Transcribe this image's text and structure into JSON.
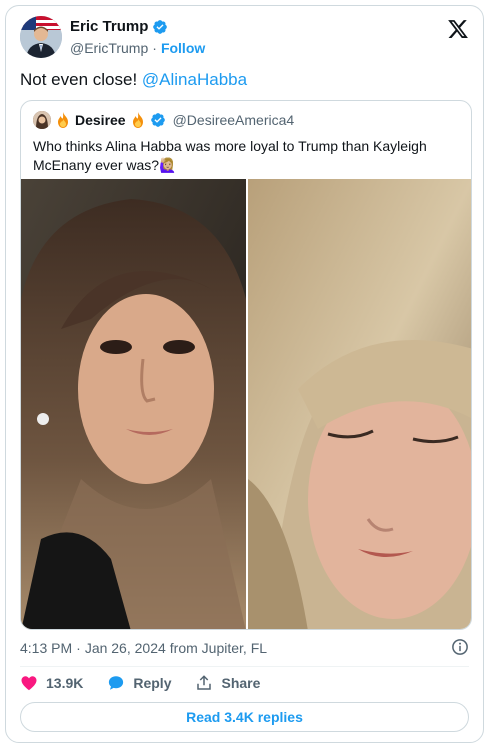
{
  "author": {
    "name": "Eric Trump",
    "handle": "@EricTrump",
    "separator": "·",
    "follow_label": "Follow",
    "avatar_icon": "profile-photo-eric-trump"
  },
  "tweet": {
    "text": "Not even close! ",
    "mention": "@AlinaHabba"
  },
  "quoted": {
    "name": "Desiree",
    "handle": "@DesireeAmerica4",
    "text": "Who thinks Alina Habba was more loyal to Trump than Kayleigh McEnany ever was?🙋🏼‍♀️",
    "images": [
      "photo-woman-brunette-closeup",
      "photo-woman-blonde-looking-down"
    ]
  },
  "meta": {
    "time": "4:13 PM",
    "separator": "·",
    "date": "Jan 26, 2024",
    "source": "from Jupiter, FL"
  },
  "actions": {
    "likes": "13.9K",
    "reply_label": "Reply",
    "share_label": "Share",
    "read_replies": "Read 3.4K replies"
  },
  "colors": {
    "accent": "#1d9bf0",
    "like": "#f91880",
    "text": "#0f1419",
    "muted": "#536471"
  }
}
